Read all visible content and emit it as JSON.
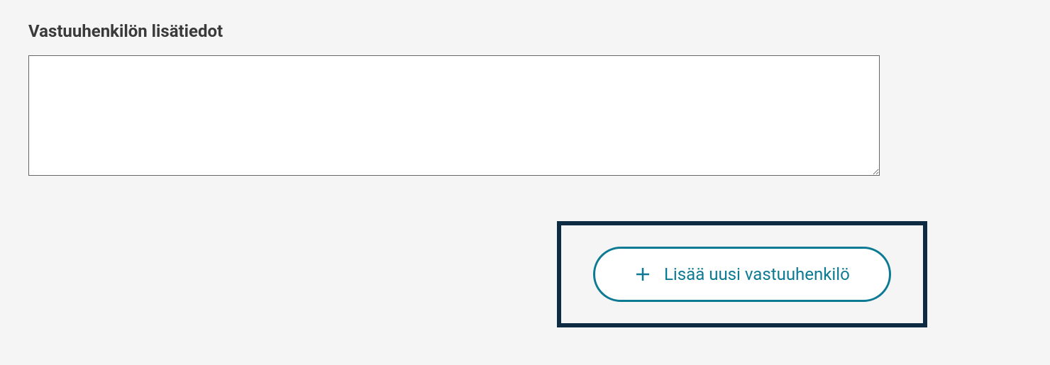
{
  "form": {
    "additional_info_label": "Vastuuhenkilön lisätiedot",
    "additional_info_value": ""
  },
  "actions": {
    "add_person_label": "Lisää uusi vastuuhenkilö"
  },
  "colors": {
    "accent": "#0d7a94",
    "highlight_border": "#0e2b44",
    "text_dark": "#3a3a3a",
    "background": "#f5f5f5"
  }
}
